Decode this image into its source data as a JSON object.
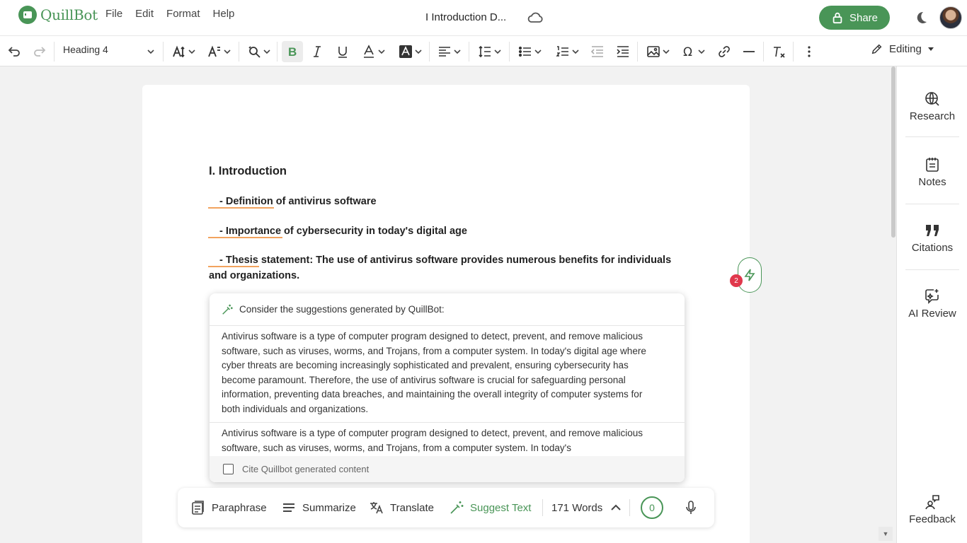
{
  "app": {
    "brand": "QuillBot",
    "doc_title": "I Introduction D...",
    "menu": [
      "File",
      "Edit",
      "Format",
      "Help"
    ],
    "share_label": "Share",
    "accent_color": "#499557"
  },
  "toolbar": {
    "text_style": "Heading 4",
    "mode_label": "Editing"
  },
  "document": {
    "heading": "I. Introduction",
    "lines": [
      "- Definition of antivirus software",
      "- Importance of cybersecurity in today's digital age",
      "- Thesis statement: The use of antivirus software provides numerous benefits for individuals",
      "and organizations."
    ],
    "flash_badge": "2"
  },
  "suggestions": {
    "header": "Consider the suggestions generated by QuillBot:",
    "items": [
      "Antivirus software is a type of computer program designed to detect, prevent, and remove malicious software, such as viruses, worms, and Trojans, from a computer system. In today's digital age where cyber threats are becoming increasingly sophisticated and prevalent, ensuring cybersecurity has become paramount. Therefore, the use of antivirus software is crucial for safeguarding personal information, preventing data breaches, and maintaining the overall integrity of computer systems for both individuals and organizations.",
      "Antivirus software is a type of computer program designed to detect, prevent, and remove malicious software, such as viruses, worms, and Trojans, from a computer system. In today's"
    ],
    "cite_label": "Cite Quillbot generated content"
  },
  "actions": {
    "paraphrase": "Paraphrase",
    "summarize": "Summarize",
    "translate": "Translate",
    "suggest_text": "Suggest Text",
    "word_count": "171 Words",
    "issue_count": "0"
  },
  "sidebar": {
    "items": [
      {
        "label": "Research",
        "icon": "globe-search-icon"
      },
      {
        "label": "Notes",
        "icon": "notes-icon"
      },
      {
        "label": "Citations",
        "icon": "quote-icon"
      },
      {
        "label": "AI Review",
        "icon": "ai-review-icon"
      }
    ],
    "feedback": "Feedback"
  }
}
